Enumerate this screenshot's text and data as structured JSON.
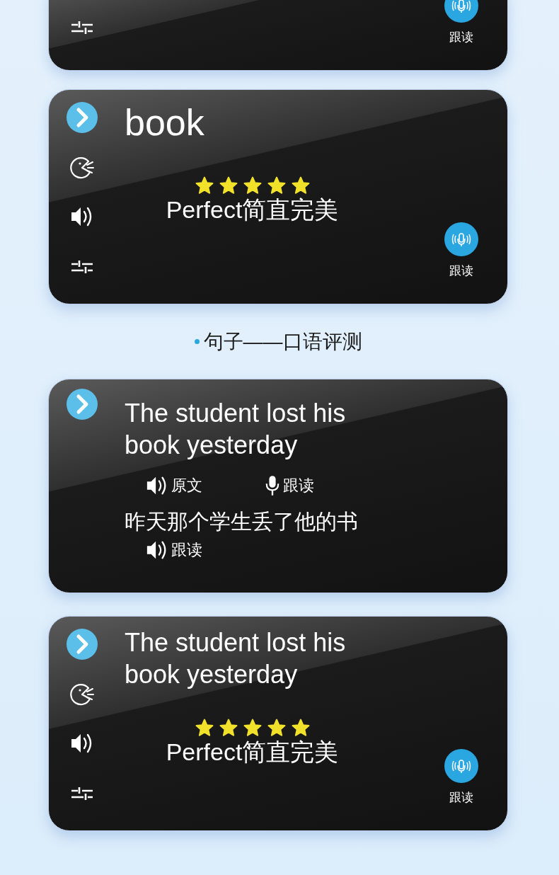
{
  "panels": [
    {
      "kind": "partial_score",
      "follow_label": "跟读"
    },
    {
      "kind": "score",
      "title": "book",
      "stars": 5,
      "verdict": "Perfect简直完美",
      "follow_label": "跟读"
    },
    {
      "kind": "heading",
      "text": "句子——口语评测"
    },
    {
      "kind": "sentence",
      "title": "The student lost his book yesterday",
      "original_label": "原文",
      "follow_label": "跟读",
      "translation": "昨天那个学生丢了他的书",
      "translation_follow_label": "跟读"
    },
    {
      "kind": "score",
      "title": "The student lost his book yesterday",
      "stars": 5,
      "verdict": "Perfect简直完美",
      "follow_label": "跟读"
    }
  ]
}
